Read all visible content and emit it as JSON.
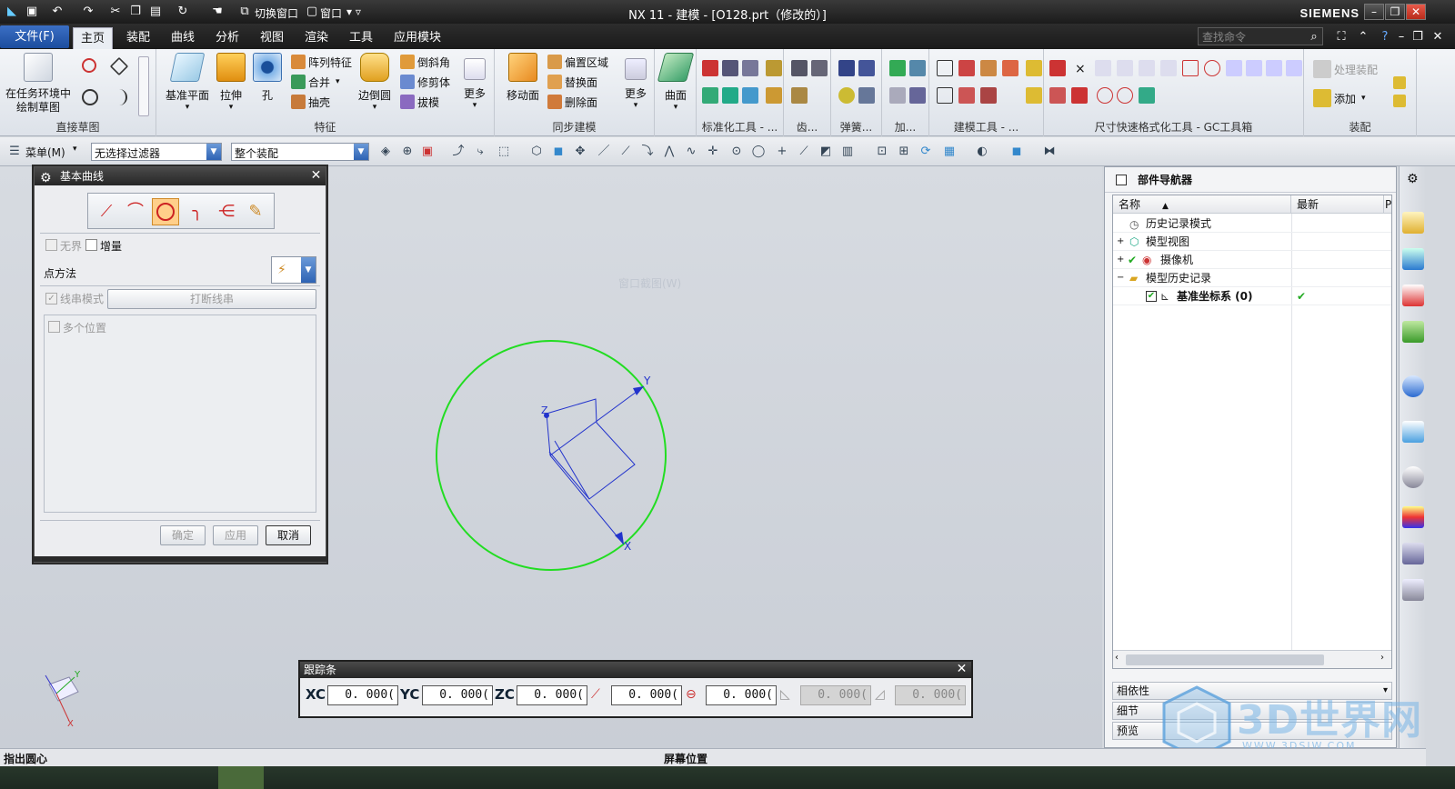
{
  "window": {
    "title": "NX 11 - 建模 - [O128.prt（修改的）]",
    "brand": "SIEMENS",
    "quick_access": {
      "switch_window": "切换窗口",
      "window_menu": "窗口"
    }
  },
  "menu": {
    "file": "文件(F)",
    "tabs": [
      "主页",
      "装配",
      "曲线",
      "分析",
      "视图",
      "渲染",
      "工具",
      "应用模块"
    ],
    "active_tab": "主页",
    "search_placeholder": "查找命令"
  },
  "ribbon": {
    "groups": {
      "direct_sketch": {
        "label": "直接草图",
        "sketch_button": "在任务环境中绘制草图"
      },
      "feature": {
        "label": "特征",
        "datum_plane": "基准平面",
        "extrude": "拉伸",
        "hole": "孔",
        "pattern": "阵列特征",
        "unite": "合并",
        "shell": "抽壳",
        "edge_blend": "边倒圆",
        "chamfer": "倒斜角",
        "trim_body": "修剪体",
        "draft": "拔模",
        "more": "更多"
      },
      "sync_modeling": {
        "label": "同步建模",
        "move_face": "移动面",
        "offset_region": "偏置区域",
        "replace_face": "替换面",
        "delete_face": "删除面",
        "more": "更多"
      },
      "surface": {
        "surface_button": "曲面"
      },
      "std_tools": {
        "label": "标准化工具 - ..."
      },
      "gear": {
        "label": "齿..."
      },
      "spring": {
        "label": "弹簧..."
      },
      "add": {
        "label": "加..."
      },
      "modeling_tools": {
        "label": "建模工具 - ..."
      },
      "dim_tools": {
        "label": "尺寸快速格式化工具 - GC工具箱"
      },
      "assembly": {
        "label": "装配",
        "process_assembly": "处理装配",
        "add": "添加"
      }
    }
  },
  "toolbar": {
    "menu": "菜单(M)",
    "selection_filter": "无选择过滤器",
    "assembly_scope": "整个装配"
  },
  "graphics": {
    "watermark": "窗口截图(W)",
    "axis_labels": {
      "x": "X",
      "y": "Y",
      "z": "Z"
    },
    "circle_color": "#22dd22",
    "csys_color": "#2233cc"
  },
  "dialog": {
    "title": "基本曲线",
    "unbounded": "无界",
    "incremental": "增量",
    "point_method": "点方法",
    "string_mode": "线串模式",
    "break_string": "打断线串",
    "multiple_positions": "多个位置",
    "ok": "确定",
    "apply": "应用",
    "cancel": "取消"
  },
  "trackbar": {
    "title": "跟踪条",
    "fields": [
      {
        "label": "XC",
        "value": "0. 000("
      },
      {
        "label": "YC",
        "value": "0. 000("
      },
      {
        "label": "ZC",
        "value": "0. 000("
      },
      {
        "label": "",
        "value": "0. 000("
      },
      {
        "label": "",
        "value": "0. 000("
      },
      {
        "label": "",
        "value": "0. 000("
      },
      {
        "label": "",
        "value": "0. 000("
      }
    ]
  },
  "navigator": {
    "title": "部件导航器",
    "columns": {
      "name": "名称",
      "latest": "最新",
      "extra": "P"
    },
    "rows": [
      {
        "label": "历史记录模式",
        "expand": ""
      },
      {
        "label": "模型视图",
        "expand": "+"
      },
      {
        "label": "摄像机",
        "expand": "+"
      },
      {
        "label": "模型历史记录",
        "expand": "−"
      },
      {
        "label": "基准坐标系 (0)",
        "expand": "",
        "latest": "✔"
      }
    ],
    "sections": [
      "相依性",
      "细节",
      "预览"
    ]
  },
  "status": {
    "prompt": "指出圆心",
    "position": "屏幕位置"
  },
  "watermark_logo": {
    "text": "3D世界网",
    "url": "WWW.3DSJW.COM"
  }
}
